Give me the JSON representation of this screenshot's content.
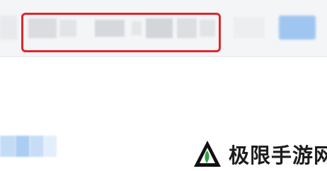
{
  "toolbar": {
    "blurred_text": "",
    "highlight_color": "#e0262b",
    "action_button_color": "#9fc6f1"
  },
  "content": {
    "title": "",
    "link_color": "#b8d6f5"
  },
  "watermark": {
    "logo_icon": "triangle-leaf-logo",
    "text": "极限手游网"
  }
}
